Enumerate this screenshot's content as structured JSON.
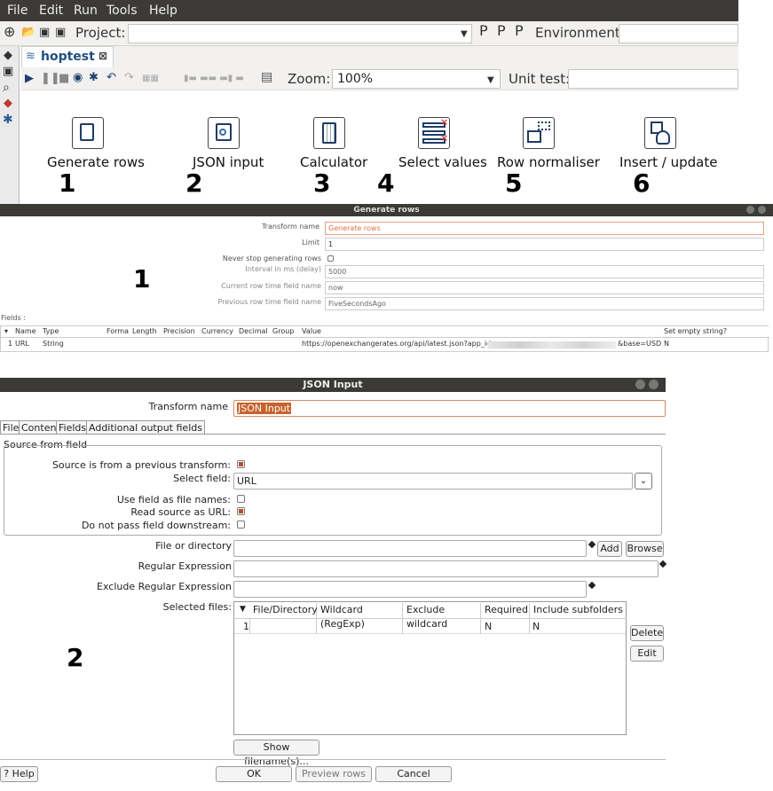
{
  "menu": [
    "File",
    "Edit",
    "Run",
    "Tools",
    "Help"
  ],
  "toolbar": {
    "project_label": "Project:",
    "environment_label": "Environment:",
    "zoom_label": "Zoom:",
    "zoom_value": "100%",
    "unit_test_label": "Unit test:"
  },
  "tab": {
    "name": "hoptest",
    "close": "⊠"
  },
  "transforms": [
    {
      "name": "Generate rows",
      "number": "1"
    },
    {
      "name": "JSON input",
      "number": "2"
    },
    {
      "name": "Calculator",
      "number": "3"
    },
    {
      "name": "Select values",
      "number": "4"
    },
    {
      "name": "Row normaliser",
      "number": "5"
    },
    {
      "name": "Insert / update",
      "number": "6"
    }
  ],
  "generate_rows": {
    "title": "Generate rows",
    "callout": "1",
    "labels": {
      "transform_name": "Transform name",
      "limit": "Limit",
      "never_stop": "Never stop generating rows",
      "interval": "Interval in ms (delay)",
      "current_row": "Current row time field name",
      "previous_row": "Previous row time field name"
    },
    "values": {
      "transform_name": "Generate rows",
      "limit": "1",
      "interval": "5000",
      "current_row": "now",
      "previous_row": "FiveSecondsAgo"
    },
    "fields_label": "Fields :",
    "columns": [
      "Name",
      "Type",
      "Forma",
      "Length",
      "Precision",
      "Currency",
      "Decimal",
      "Group",
      "Value",
      "Set empty string?"
    ],
    "row": {
      "index": "1",
      "name": "URL",
      "type": "String",
      "value_prefix": "https://openexchangerates.org/api/latest.json?app_id=",
      "value_suffix": "&base=USD",
      "set_empty": "N"
    }
  },
  "json_input": {
    "title": "JSON Input",
    "callout": "2",
    "transform_name_label": "Transform name",
    "transform_name_value": "JSON Input",
    "tabs": [
      "File",
      "Content",
      "Fields",
      "Additional output fields"
    ],
    "source_group": "Source from field",
    "labels": {
      "source_prev": "Source is from a previous transform:",
      "select_field": "Select field:",
      "use_field": "Use field as file names:",
      "read_url": "Read source as URL:",
      "no_pass": "Do not pass field downstream:",
      "file_or_dir": "File or directory",
      "regex": "Regular Expression",
      "exclude_regex": "Exclude Regular Expression",
      "selected_files": "Selected files:"
    },
    "select_field_value": "URL",
    "buttons": {
      "add": "Add",
      "browse": "Browse",
      "delete": "Delete",
      "edit": "Edit",
      "show_filenames": "Show filename(s)...",
      "help": "Help",
      "ok": "OK",
      "preview": "Preview rows",
      "cancel": "Cancel"
    },
    "table_columns": [
      "File/Directory",
      "Wildcard (RegExp)",
      "Exclude wildcard",
      "Required",
      "Include subfolders"
    ],
    "table_row": {
      "index": "1",
      "required": "N",
      "include_subfolders": "N"
    }
  }
}
